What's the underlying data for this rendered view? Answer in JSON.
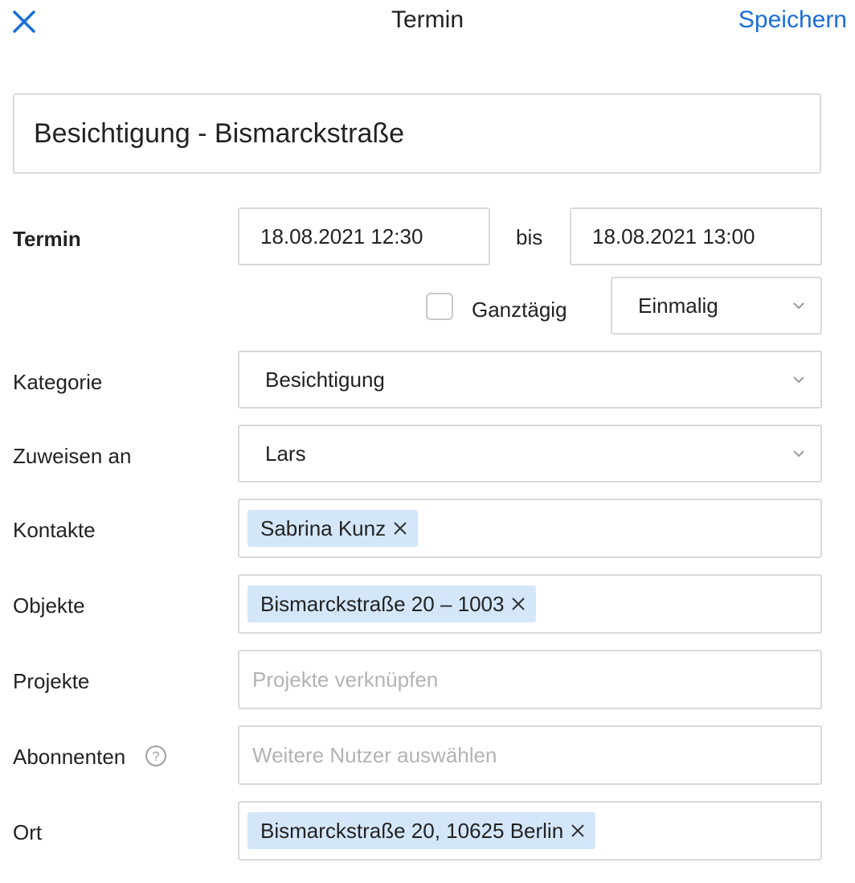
{
  "header": {
    "title": "Termin",
    "save_label": "Speichern",
    "accent_color": "#1a6ed8"
  },
  "event": {
    "title": "Besichtigung - Bismarckstraße"
  },
  "termin": {
    "label": "Termin",
    "start": "18.08.2021 12:30",
    "separator": "bis",
    "end": "18.08.2021 13:00",
    "all_day_label": "Ganztägig",
    "all_day_checked": false,
    "recurrence": "Einmalig"
  },
  "kategorie": {
    "label": "Kategorie",
    "value": "Besichtigung"
  },
  "zuweisen": {
    "label": "Zuweisen an",
    "value": "Lars"
  },
  "kontakte": {
    "label": "Kontakte",
    "tags": [
      "Sabrina Kunz"
    ]
  },
  "objekte": {
    "label": "Objekte",
    "tags": [
      "Bismarckstraße 20 – 1003"
    ]
  },
  "projekte": {
    "label": "Projekte",
    "placeholder": "Projekte verknüpfen"
  },
  "abonnenten": {
    "label": "Abonnenten",
    "placeholder": "Weitere Nutzer auswählen",
    "help_icon": "question-circle-icon"
  },
  "ort": {
    "label": "Ort",
    "tags": [
      "Bismarckstraße 20, 10625 Berlin"
    ]
  },
  "tag_color": "#d4e7fa"
}
